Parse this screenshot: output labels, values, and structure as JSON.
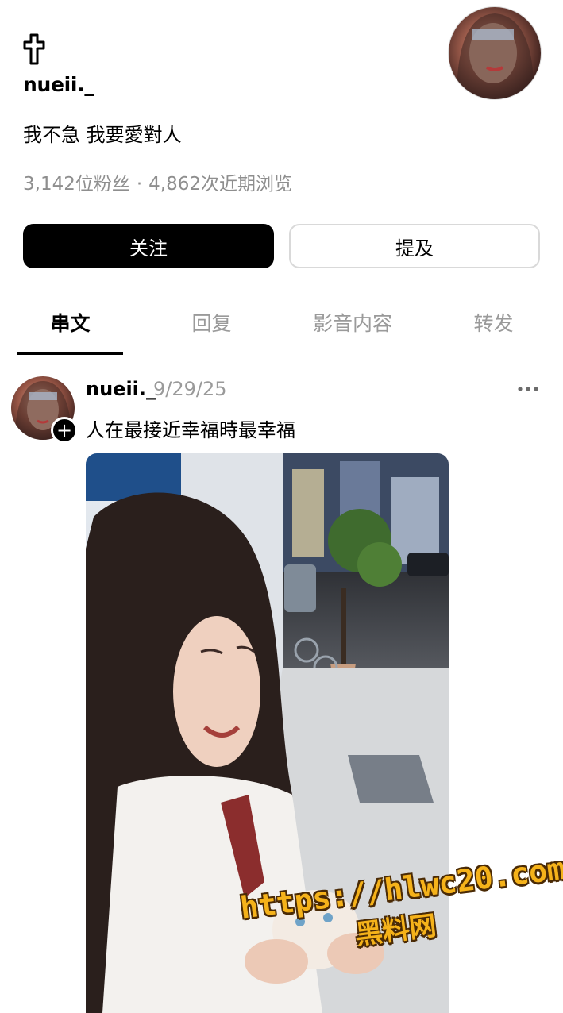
{
  "profile": {
    "icon": "latin-cross-icon",
    "username": "nueii._",
    "bio": "我不急 我要愛對人",
    "followers": "3,142位粉丝",
    "separator": "·",
    "recent_views": "4,862次近期浏览",
    "follow_label": "关注",
    "mention_label": "提及"
  },
  "tabs": [
    {
      "label": "串文",
      "active": true
    },
    {
      "label": "回复",
      "active": false
    },
    {
      "label": "影音内容",
      "active": false
    },
    {
      "label": "转发",
      "active": false
    }
  ],
  "post": {
    "username": "nueii._",
    "date": "9/29/25",
    "text": "人在最接近幸福時最幸福",
    "more_icon": "more-horizontal-icon",
    "follow_icon": "plus-icon"
  },
  "watermark": {
    "line1": "https://hlwc20.com",
    "line2": "黑料网"
  },
  "colors": {
    "primary_button": "#000000",
    "secondary_text": "#8e8e8e",
    "watermark": "#f5b21a"
  }
}
